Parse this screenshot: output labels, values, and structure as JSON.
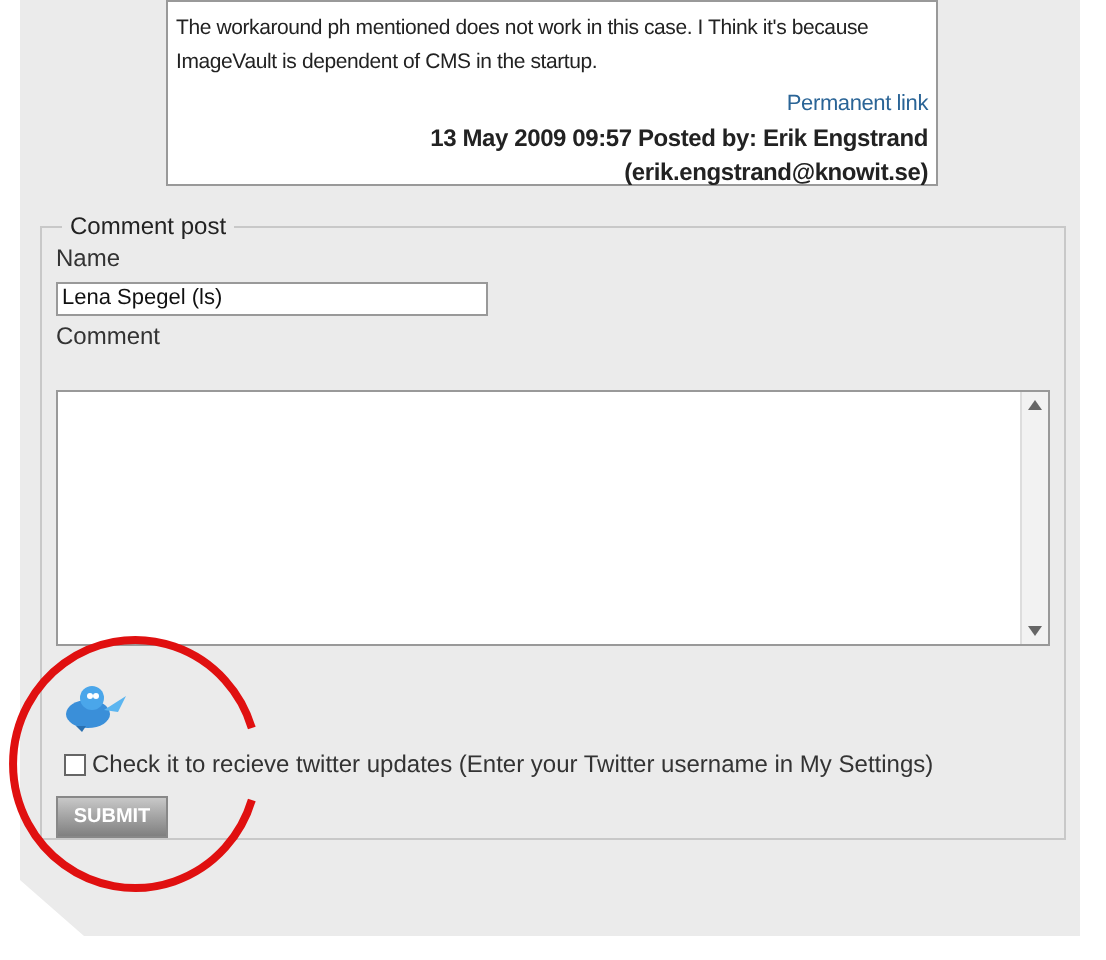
{
  "comment": {
    "text": "The workaround ph mentioned does not work in this case. I Think it's because ImageVault is dependent of CMS in the startup.",
    "permalink": "Permanent link",
    "posted": "13 May 2009 09:57 Posted by: Erik Engstrand",
    "email": "(erik.engstrand@knowit.se)"
  },
  "form": {
    "legend": "Comment post",
    "name_label": "Name",
    "name_value": "Lena Spegel (ls)",
    "comment_label": "Comment",
    "twitter": {
      "checked": false,
      "label": "Check it to recieve twitter updates (Enter your Twitter username in My Settings)"
    },
    "submit": "SUBMIT"
  }
}
